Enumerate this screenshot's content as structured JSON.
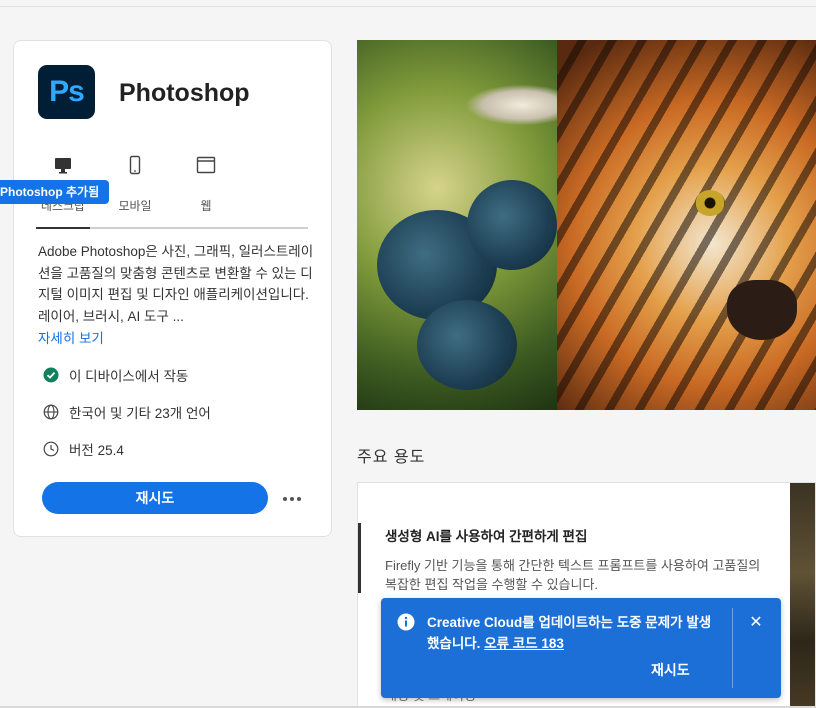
{
  "app": {
    "logo_text": "Ps",
    "name": "Photoshop",
    "tabs": [
      {
        "label": "데스크탑",
        "icon": "desktop-icon"
      },
      {
        "label": "모바일",
        "icon": "mobile-icon"
      },
      {
        "label": "웹",
        "icon": "browser-icon"
      }
    ],
    "tooltip": "Photoshop 추가됨",
    "description": "Adobe Photoshop은 사진, 그래픽, 일러스트레이션을 고품질의 맞춤형 콘텐츠로 변환할 수 있는 디지털 이미지 편집 및 디자인 애플리케이션입니다. 레이어, 브러시, AI 도구 ...",
    "more_link": "자세히 보기",
    "info": [
      {
        "icon": "check-circle-icon",
        "text": "이 디바이스에서 작동"
      },
      {
        "icon": "globe-icon",
        "text": "한국어 및 기타 23개 언어"
      },
      {
        "icon": "clock-icon",
        "text": "버전 25.4"
      }
    ],
    "retry_button": "재시도",
    "more_actions_icon": "more-horizontal-icon"
  },
  "main": {
    "section_title": "주요 용도",
    "feature": {
      "title": "생성형 AI를 사용하여 간편하게 편집",
      "description": "Firefly 기반 기능을 통해 간단한 텍스트 프롬프트를 사용하여 고품질의 복잡한 편집 작업을 수행할 수 있습니다.",
      "next_item_partial": "배경 및 그레이딩"
    }
  },
  "toast": {
    "icon": "info-icon",
    "message": "Creative Cloud를 업데이트하는 도중 문제가 발생했습니다.",
    "error_link": "오류 코드 183",
    "retry": "재시도",
    "close_icon": "close-icon"
  },
  "colors": {
    "accent": "#1473e6",
    "toast_bg": "#1b6fd6",
    "ps_logo_bg": "#001e36",
    "ps_logo_text": "#31a8ff",
    "success": "#12805c"
  }
}
